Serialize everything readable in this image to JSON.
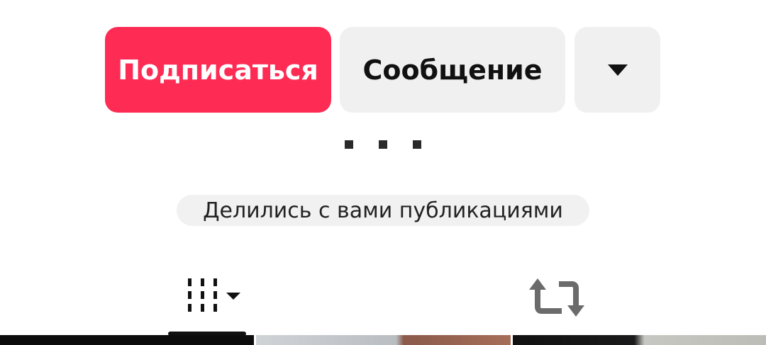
{
  "actions": {
    "follow_label": "Подписаться",
    "message_label": "Сообщение",
    "more_icon": "caret-down-icon"
  },
  "bio": {
    "dots_icon": "ellipsis-icon"
  },
  "shared_posts": {
    "label": "Делились с вами публикациями"
  },
  "tabs": [
    {
      "name": "videos-grid",
      "icon": "grid-bars-icon",
      "has_dropdown": true,
      "active": true
    },
    {
      "name": "reposts",
      "icon": "repost-icon",
      "active": false
    }
  ],
  "colors": {
    "accent": "#fe2c55",
    "secondary_button": "#f0f0f0",
    "text_dark": "#111111",
    "icon_gray": "#6b6b6b"
  }
}
